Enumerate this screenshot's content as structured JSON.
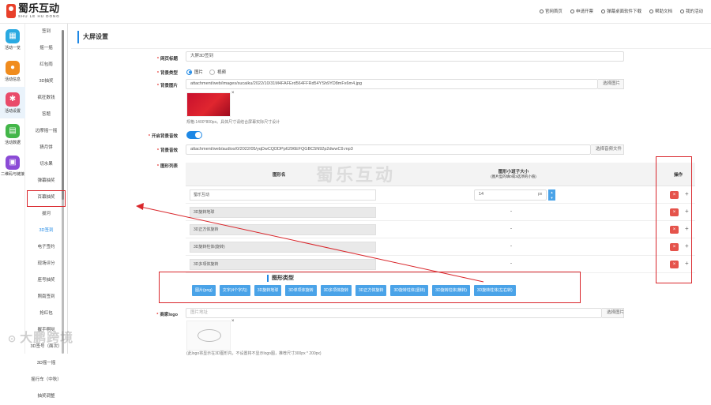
{
  "brand": {
    "name": "蜀乐互动",
    "sub": "SHU LE HU DONG"
  },
  "topnav": [
    "官网首页",
    "申请开票",
    "弹幕桌面软件下载",
    "帮助文档",
    "我的活动"
  ],
  "nav1": [
    {
      "label": "活动一览",
      "color": "#29a9e1",
      "icon": "grid-icon"
    },
    {
      "label": "活动信息",
      "color": "#f08c1e",
      "icon": "info-icon"
    },
    {
      "label": "活动设置",
      "color": "#e94b6a",
      "icon": "gear-icon",
      "active": true
    },
    {
      "label": "活动数据",
      "color": "#43b649",
      "icon": "chart-icon"
    },
    {
      "label": "二维码与链接",
      "color": "#8b4bd6",
      "icon": "qrcode-icon"
    }
  ],
  "nav2": [
    "签到",
    "摇一摇",
    "红包雨",
    "3D抽奖",
    "疯狂数钱",
    "答题",
    "边摩摇一摇",
    "猜月饼",
    "切水果",
    "弹幕抽奖",
    "百幕抽奖",
    "拔河",
    "3D签到",
    "电子签约",
    "现场评分",
    "座号抽奖",
    "照南签到",
    "抢红包",
    "握手啊哒",
    "3D签号（面次）",
    "3D摇一摇",
    "摇行车（中秋）",
    "抽奖调整"
  ],
  "active_nav2": "3D签到",
  "page_title": "大屏设置",
  "form": {
    "title_label": "网页标题",
    "title_value": "大屏3D签到",
    "bg_type_label": "背景类型",
    "bg_type_options": [
      "图片",
      "视频"
    ],
    "bg_type_selected": "图片",
    "bg_image_label": "背景图片",
    "bg_image_path": "attachment/web/images/sucaiku/2022/10/31M4FAFErd564FFRd54YSh9YD8mFx6m4.jpg",
    "bg_image_button": "选择图片",
    "bg_image_hint": "规格:1400*800px。具体尺寸请结合屏幕实际尺寸设计",
    "music_switch_label": "开启背景音效",
    "music_switch_on": true,
    "music_label": "背景音效",
    "music_path": "attachment/web/audios/0/2022/05/yqDwCQDDPp6296EFQGBC5N92p2dwwC9.mp3",
    "music_button": "选择音频文件",
    "shapes_label": "图形列表",
    "logo_label": "商家logo",
    "logo_placeholder": "图片地址",
    "logo_button": "选择图片",
    "logo_hint": "(此logo将显示在3D图形内，不设置将不显示logo图，推荐尺寸300px * 200px)"
  },
  "table": {
    "col_name": "图形名",
    "col_size_line1": "图形小班子大小",
    "col_size_line2": "(图片型的填0或3选项的小值)",
    "col_action": "操作",
    "rows": [
      {
        "name": "蜀乐互动",
        "editable": true,
        "size": "14",
        "unit": "px"
      },
      {
        "name": "3D旋转地球",
        "editable": false,
        "size": "-"
      },
      {
        "name": "3D正方体旋转",
        "editable": false,
        "size": "-"
      },
      {
        "name": "3D旋转柱体(旋转)",
        "editable": false,
        "size": "-"
      },
      {
        "name": "3D多項体旋转",
        "editable": false,
        "size": "-"
      }
    ],
    "del_label": "×",
    "add_label": "+"
  },
  "shape_types": {
    "title": "图形类型",
    "chips": [
      "图片(png)",
      "文字(4个字内)",
      "3D旋转地球",
      "3D单项体旋转",
      "3D多项体旋转",
      "3D正方体旋转",
      "3D旋转柱体(竖转)",
      "3D旋转柱体(横转)",
      "3D旋转柱体(左右转)"
    ]
  },
  "watermark": {
    "center": "蜀乐互动",
    "corner": "大鹏跨境"
  },
  "colors": {
    "accent": "#1e88e5",
    "danger": "#e5534b",
    "chip": "#4aa3e8",
    "annotation": "#d9262b"
  }
}
